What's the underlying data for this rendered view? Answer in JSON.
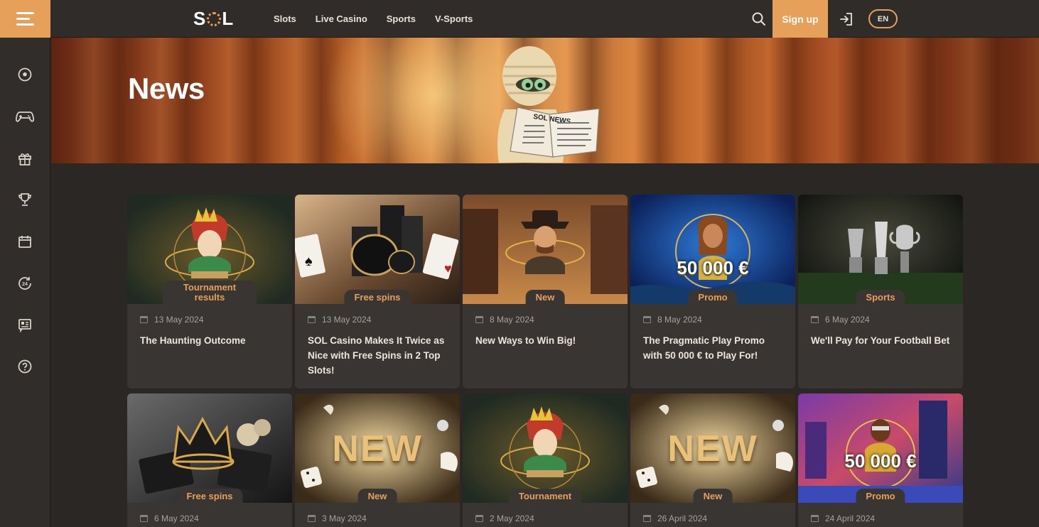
{
  "header": {
    "logo": "SOL",
    "nav": [
      "Slots",
      "Live Casino",
      "Sports",
      "V-Sports"
    ],
    "signup_label": "Sign up",
    "lang": "EN"
  },
  "sidebar": {
    "icons": [
      "football-icon",
      "gamepad-icon",
      "gift-icon",
      "trophy-icon",
      "calendar-icon",
      "support-24-icon",
      "news-icon",
      "help-icon"
    ]
  },
  "hero": {
    "title": "News",
    "newspaper_text": "SOL NEWS"
  },
  "cards": [
    {
      "tag": "Tournament results",
      "date": "13 May 2024",
      "title": "The Haunting Outcome",
      "image": "aztec-tournament"
    },
    {
      "tag": "Free spins",
      "date": "13 May 2024",
      "title": "SOL Casino Makes It Twice as Nice with Free Spins in 2 Top Slots!",
      "image": "poker-chips"
    },
    {
      "tag": "New",
      "date": "8 May 2024",
      "title": "New Ways to Win Big!",
      "image": "cowboy"
    },
    {
      "tag": "Promo",
      "date": "8 May 2024",
      "title": "The Pragmatic Play Promo with 50 000 € to Play For!",
      "image": "pragmatic-promo",
      "art_text": "50 000 €"
    },
    {
      "tag": "Sports",
      "date": "6 May 2024",
      "title": "We'll Pay for Your Football Bet",
      "image": "trophies"
    },
    {
      "tag": "Free spins",
      "date": "6 May 2024",
      "title": "",
      "image": "crown-cards"
    },
    {
      "tag": "New",
      "date": "3 May 2024",
      "title": "",
      "image": "new-banner",
      "art_text": "NEW"
    },
    {
      "tag": "Tournament",
      "date": "2 May 2024",
      "title": "",
      "image": "aztec-tournament"
    },
    {
      "tag": "New",
      "date": "26 April 2024",
      "title": "",
      "image": "new-banner",
      "art_text": "NEW"
    },
    {
      "tag": "Promo",
      "date": "24 April 2024",
      "title": "",
      "image": "city-promo",
      "art_text": "50 000 €"
    }
  ],
  "colors": {
    "accent": "#e7a05a",
    "background": "#2a2725",
    "card": "#393532"
  }
}
